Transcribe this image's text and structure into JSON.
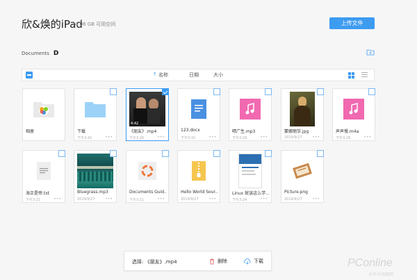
{
  "header": {
    "title": "欣&焕的iPad",
    "space": "4.06 GB 可用空间",
    "upload_label": "上传文件"
  },
  "breadcrumb": {
    "label": "Documents"
  },
  "toolbar": {
    "sort_name": "名称",
    "sort_date": "日期",
    "sort_size": "大小"
  },
  "files": [
    {
      "name": "相册",
      "meta": "",
      "type": "photos-folder",
      "checkbox": false
    },
    {
      "name": "下载",
      "meta": "下午3:42",
      "type": "folder",
      "checkbox": true
    },
    {
      "name": "《朋友》.mp4",
      "meta": "下午3:26",
      "type": "video",
      "duration": "4:42",
      "checkbox": true,
      "selected": true
    },
    {
      "name": "123.docx",
      "meta": "下午3:32",
      "type": "docx",
      "checkbox": true
    },
    {
      "name": "晴广生.mp3",
      "meta": "下午3:29",
      "type": "audio",
      "checkbox": true
    },
    {
      "name": "蒙娜丽莎.jpg",
      "meta": "2019/9/27",
      "type": "image-mona",
      "checkbox": true
    },
    {
      "name": "声声慢.m4a",
      "meta": "下午3:28",
      "type": "audio",
      "checkbox": true
    },
    {
      "name": "海正是帝.txt",
      "meta": "下午3:21",
      "type": "txt",
      "checkbox": true
    },
    {
      "name": "Bluegrass.mp3",
      "meta": "2019/9/27",
      "type": "album",
      "checkbox": true
    },
    {
      "name": "Documents Guid...",
      "meta": "下午3:11",
      "type": "guide",
      "checkbox": true
    },
    {
      "name": "Hello World Sour...",
      "meta": "2019/9/27",
      "type": "zip",
      "checkbox": true
    },
    {
      "name": "Linux 就该这么学...",
      "meta": "下午3:24",
      "type": "book",
      "checkbox": true
    },
    {
      "name": "Picture.png",
      "meta": "2019/9/27",
      "type": "picture",
      "checkbox": true
    }
  ],
  "bottombar": {
    "selection": "选择: 《朋友》.mp4",
    "delete_label": "删除",
    "download_label": "下载"
  },
  "watermark": {
    "brand": "PConline",
    "sub": "太平洋电脑网"
  },
  "colors": {
    "accent": "#3d9bf0",
    "audio": "#f169b0",
    "docx": "#4a90e2"
  }
}
